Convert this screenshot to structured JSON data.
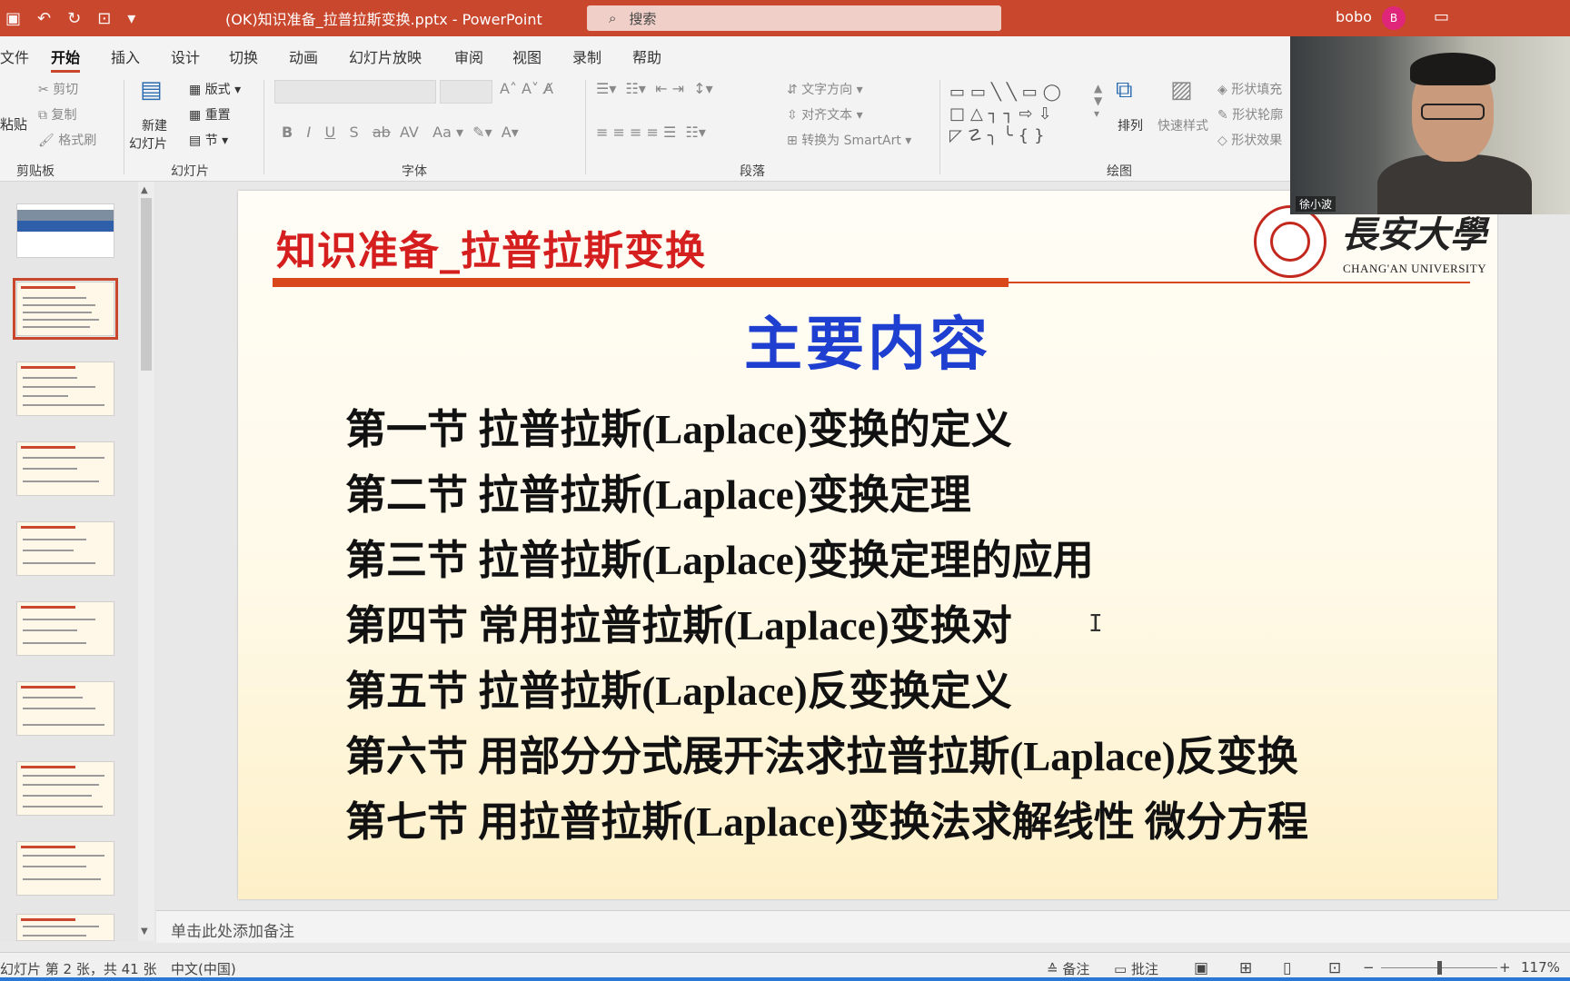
{
  "titlebar": {
    "doc_title": "(OK)知识准备_拉普拉斯变换.pptx - PowerPoint",
    "search_placeholder": "搜索",
    "user_name": "bobo",
    "avatar_initial": "B",
    "accent_color": "#c9472d"
  },
  "tabs": [
    {
      "label": "文件"
    },
    {
      "label": "开始"
    },
    {
      "label": "插入"
    },
    {
      "label": "设计"
    },
    {
      "label": "切换"
    },
    {
      "label": "动画"
    },
    {
      "label": "幻灯片放映"
    },
    {
      "label": "审阅"
    },
    {
      "label": "视图"
    },
    {
      "label": "录制"
    },
    {
      "label": "帮助"
    }
  ],
  "ribbon": {
    "clipboard": {
      "paste": "粘贴",
      "cut": "剪切",
      "copy": "复制",
      "format_painter": "格式刷",
      "group": "剪贴板"
    },
    "slides": {
      "new_slide_1": "新建",
      "new_slide_2": "幻灯片",
      "layout": "版式",
      "reset": "重置",
      "section": "节",
      "group": "幻灯片"
    },
    "font": {
      "bold": "B",
      "italic": "I",
      "underline": "U",
      "strike": "S",
      "case": "Aa",
      "group": "字体"
    },
    "paragraph": {
      "text_direction": "文字方向",
      "align_text": "对齐文本",
      "smartart": "转换为 SmartArt",
      "group": "段落"
    },
    "drawing": {
      "arrange": "排列",
      "quick_styles": "快速样式",
      "shape_fill": "形状填充",
      "shape_outline": "形状轮廓",
      "shape_effects": "形状效果",
      "group": "绘图"
    }
  },
  "slide": {
    "title": "知识准备_拉普拉斯变换",
    "university_cn": "長安大學",
    "university_en": "CHANG'AN UNIVERSITY",
    "heading": "主要内容",
    "items": [
      "第一节  拉普拉斯(Laplace)变换的定义",
      "第二节  拉普拉斯(Laplace)变换定理",
      "第三节  拉普拉斯(Laplace)变换定理的应用",
      "第四节  常用拉普拉斯(Laplace)变换对",
      "第五节  拉普拉斯(Laplace)反变换定义",
      "第六节   用部分分式展开法求拉普拉斯(Laplace)反变换",
      "第七节  用拉普拉斯(Laplace)变换法求解线性 微分方程"
    ]
  },
  "notes_placeholder": "单击此处添加备注",
  "webcam": {
    "participant_name": "徐小波"
  },
  "statusbar": {
    "slide_info": "幻灯片 第 2 张，共 41 张",
    "language": "中文(中国)",
    "notes": "备注",
    "comments": "批注",
    "zoom": "117%"
  }
}
